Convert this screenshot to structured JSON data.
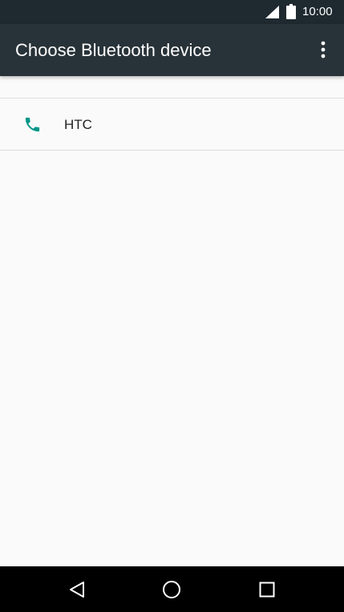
{
  "status_bar": {
    "time": "10:00",
    "icons": [
      "signal-icon",
      "battery-icon"
    ]
  },
  "app_bar": {
    "title": "Choose Bluetooth device",
    "menu_icon": "more-vert-icon"
  },
  "devices": [
    {
      "name": "HTC",
      "icon": "phone-icon"
    }
  ],
  "nav_bar": {
    "buttons": [
      "back-icon",
      "home-icon",
      "recents-icon"
    ]
  },
  "colors": {
    "status_bar": "#1f2a30",
    "app_bar": "#283339",
    "background": "#fafafa",
    "accent": "#009688",
    "nav_bar": "#000000"
  }
}
